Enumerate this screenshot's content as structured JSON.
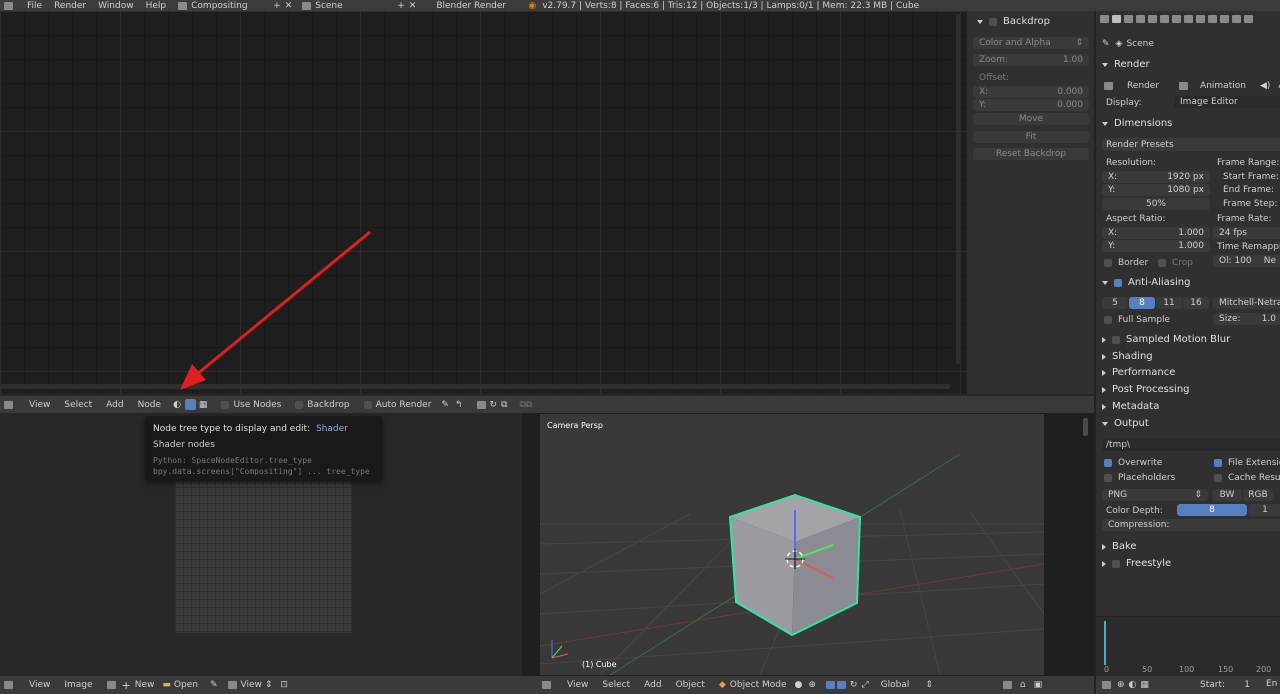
{
  "menu": {
    "file": "File",
    "render": "Render",
    "window": "Window",
    "help": "Help",
    "layout": "Compositing",
    "scene": "Scene",
    "engine": "Blender Render",
    "stats": "v2.79.7 | Verts:8 | Faces:6 | Tris:12 | Objects:1/3 | Lamps:0/1 | Mem: 22.3 MB | Cube"
  },
  "backdrop": {
    "title": "Backdrop",
    "channels": "Color and Alpha",
    "zoom_label": "Zoom:",
    "zoom_value": "1.00",
    "offset_label": "Offset:",
    "x_label": "X:",
    "x_value": "0.000",
    "y_label": "Y:",
    "y_value": "0.000",
    "move": "Move",
    "fit": "Fit",
    "reset": "Reset Backdrop"
  },
  "node_header": {
    "view": "View",
    "select": "Select",
    "add": "Add",
    "node": "Node",
    "use_nodes": "Use Nodes",
    "backdrop": "Backdrop",
    "auto_render": "Auto Render"
  },
  "tooltip": {
    "title": "Node tree type to display and edit:",
    "value": "Shader",
    "subtitle": "Shader nodes",
    "python1": "Python: SpaceNodeEditor.tree_type",
    "python2": "bpy.data.screens[\"Compositing\"] ... tree_type"
  },
  "viewport": {
    "label": "Camera Persp",
    "object": "(1) Cube"
  },
  "image_header": {
    "view": "View",
    "image": "Image",
    "new": "New",
    "open": "Open",
    "view2": "View"
  },
  "view3d_header": {
    "view": "View",
    "select": "Select",
    "add": "Add",
    "object": "Object",
    "mode": "Object Mode",
    "orient": "Global"
  },
  "props": {
    "scene": "Scene",
    "render": "Render",
    "render_btn": "Render",
    "animation_btn": "Animation",
    "audio_btn": "Au",
    "display_label": "Display:",
    "display_value": "Image Editor",
    "dimensions": "Dimensions",
    "presets": "Render Presets",
    "resolution": "Resolution:",
    "res_x_label": "X:",
    "res_x": "1920 px",
    "res_y_label": "Y:",
    "res_y": "1080 px",
    "res_pct": "50%",
    "frame_range": "Frame Range:",
    "start_frame": "Start Frame:",
    "end_frame": "End Frame:",
    "frame_step": "Frame Step:",
    "aspect": "Aspect Ratio:",
    "asp_x_label": "X:",
    "asp_x": "1.000",
    "asp_y_label": "Y:",
    "asp_y": "1.000",
    "frame_rate": "Frame Rate:",
    "fps": "24 fps",
    "time_remap": "Time Remapping",
    "remap_old": "Ol: 100",
    "remap_new": "Ne",
    "border": "Border",
    "crop": "Crop",
    "aa": "Anti-Aliasing",
    "aa_samples": [
      "5",
      "8",
      "11",
      "16"
    ],
    "aa_filter": "Mitchell-Netraval",
    "full_sample": "Full Sample",
    "size_label": "Size:",
    "size_value": "1.0",
    "motion_blur": "Sampled Motion Blur",
    "shading": "Shading",
    "performance": "Performance",
    "post": "Post Processing",
    "metadata": "Metadata",
    "output": "Output",
    "path": "/tmp\\",
    "overwrite": "Overwrite",
    "file_ext": "File Extension",
    "placeholders": "Placeholders",
    "cache": "Cache Result",
    "format": "PNG",
    "bw": "BW",
    "rgb": "RGB",
    "color_depth": "Color Depth:",
    "depth_8": "8",
    "depth_16": "1",
    "compression": "Compression:",
    "bake": "Bake",
    "freestyle": "Freestyle"
  },
  "timeline": {
    "ticks": [
      "0",
      "50",
      "100",
      "150",
      "200"
    ],
    "start_label": "Start:",
    "start_value": "1",
    "end_label": "En"
  },
  "colors": {
    "accent": "#5680c2",
    "selection": "#2fe6a0",
    "arrow": "#e02020"
  }
}
